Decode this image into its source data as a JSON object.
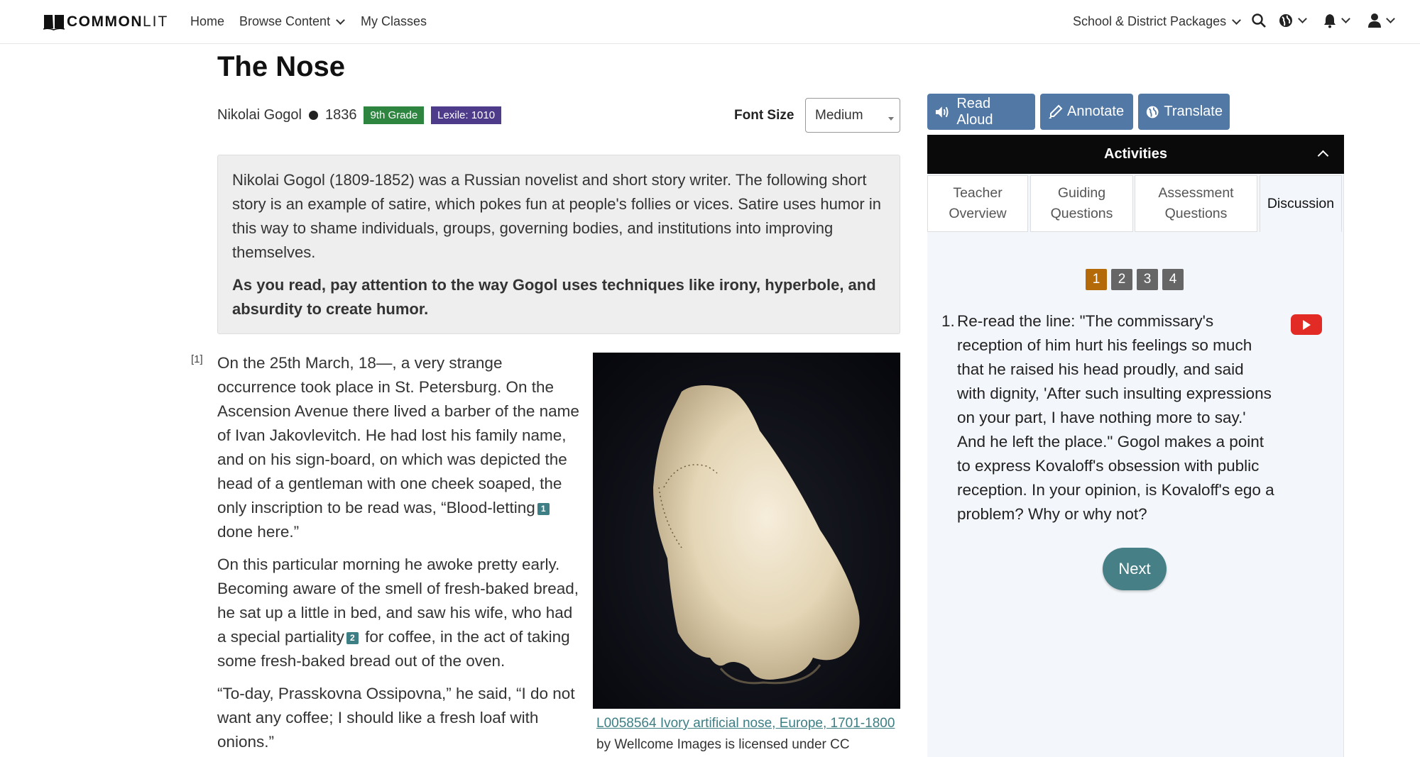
{
  "nav": {
    "logo_bold": "COMMON",
    "logo_light": "LIT",
    "links": [
      {
        "label": "Home"
      },
      {
        "label": "Browse Content",
        "dropdown": true
      },
      {
        "label": "My Classes"
      }
    ],
    "packages_label": "School & District Packages",
    "icons": [
      "search-icon",
      "globe-icon",
      "bell-icon",
      "user-icon"
    ]
  },
  "text": {
    "title": "The Nose",
    "author": "Nikolai Gogol",
    "year": "1836",
    "grade_badge": "9th Grade",
    "lexile_badge": "Lexile: 1010",
    "badge_colors": {
      "grade": "#2e8540",
      "lexile": "#4e3c8a"
    }
  },
  "font_size": {
    "label": "Font Size",
    "selected": "Medium"
  },
  "intro": {
    "paragraph": "Nikolai Gogol (1809-1852) was a Russian novelist and short story writer. The following short story is an example of satire, which pokes fun at people's follies or vices. Satire uses humor in this way to shame individuals, groups, governing bodies, and institutions into improving themselves.",
    "prompt": "As you read, pay attention to the way Gogol uses techniques like irony, hyperbole, and absurdity to create humor."
  },
  "story": {
    "paragraph_number": "[1]",
    "p1_a": "On the 25th March, 18—, a very strange occurrence took place in St. Petersburg. On the Ascension Avenue there lived a barber of the name of Ivan Jakovlevitch. He had lost his family name, and on his sign-board, on which was depicted the head of a gentleman with one cheek soaped, the only inscription to be read was, “Blood-letting",
    "p1_fn": "1",
    "p1_b": " done here.”",
    "p2_a": "On this particular morning he awoke pretty early. Becoming aware of the smell of fresh-baked bread, he sat up a little in bed, and saw his wife, who had a special partiality",
    "p2_fn": "2",
    "p2_b": " for coffee, in the act of taking some fresh-baked bread out of the oven.",
    "p3": "“To-day, Prasskovna Ossipovna,” he said, “I do not want any coffee; I should like a fresh loaf with onions.”"
  },
  "image": {
    "alt": "Ivory artificial nose",
    "caption_link": "L0058564 Ivory artificial nose, Europe, 1701-1800",
    "caption_rest": " by Wellcome Images is licensed under CC"
  },
  "tools": {
    "read_aloud": "Read Aloud",
    "annotate": "Annotate",
    "translate": "Translate",
    "color": "#5279a6"
  },
  "activities": {
    "header": "Activities",
    "tabs": [
      {
        "label": "Teacher Overview",
        "active": false
      },
      {
        "label": "Guiding Questions",
        "active": false
      },
      {
        "label": "Assessment Questions",
        "active": false
      },
      {
        "label": "Discussion",
        "active": true
      }
    ],
    "pages": [
      "1",
      "2",
      "3",
      "4"
    ],
    "current_page": "1",
    "question_number": "1.",
    "question": "Re-read the line: \"The commissary's reception of him hurt his feelings so much that he raised his head proudly, and said with dignity, 'After such insulting expressions on your part, I have nothing more to say.' And he left the place.\" Gogol makes a point to express Kovaloff's obsession with public reception. In your opinion, is Kovaloff's ego a problem? Why or why not?",
    "next_label": "Next",
    "accent_active_page": "#b46a08",
    "next_color": "#467f86"
  }
}
